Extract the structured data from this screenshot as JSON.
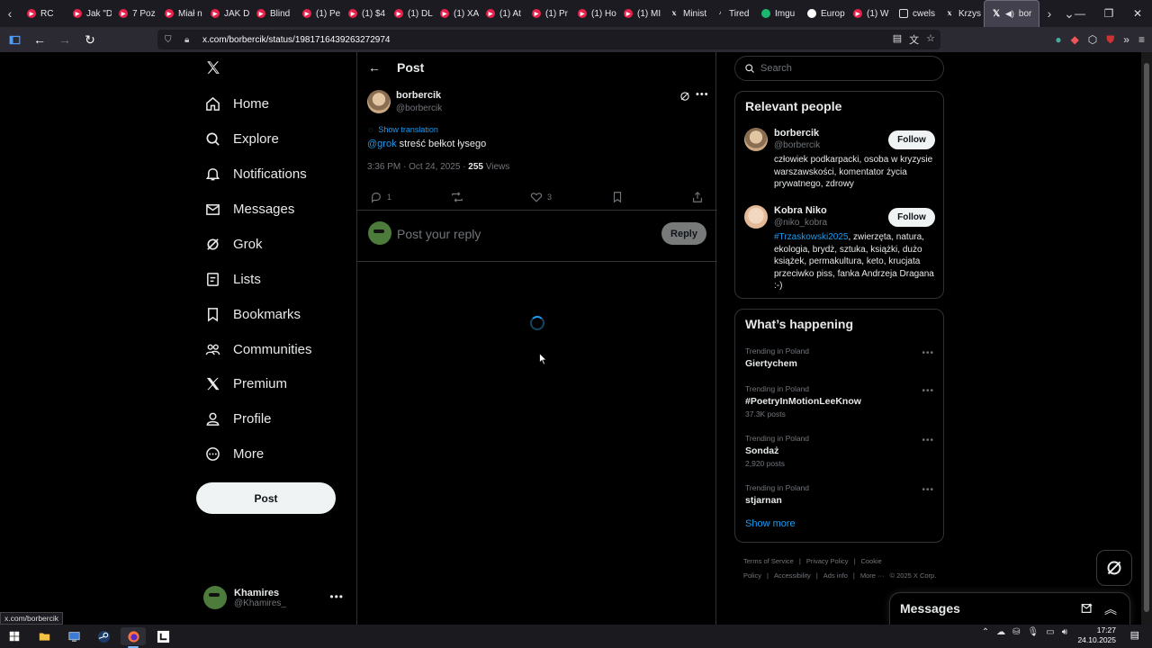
{
  "browser": {
    "tabs": [
      {
        "label": "RC",
        "favicon": "yt"
      },
      {
        "label": "Jak \"D",
        "favicon": "yt"
      },
      {
        "label": "7 Poz",
        "favicon": "yt"
      },
      {
        "label": "Miał n",
        "favicon": "yt"
      },
      {
        "label": "JAK D",
        "favicon": "yt"
      },
      {
        "label": "Blind",
        "favicon": "yt"
      },
      {
        "label": "(1) Pe",
        "favicon": "yt"
      },
      {
        "label": "(1) $4",
        "favicon": "yt"
      },
      {
        "label": "(1) DL",
        "favicon": "yt"
      },
      {
        "label": "(1) XA",
        "favicon": "yt"
      },
      {
        "label": "(1) At",
        "favicon": "yt"
      },
      {
        "label": "(1) Pr",
        "favicon": "yt"
      },
      {
        "label": "(1) Ho",
        "favicon": "yt"
      },
      {
        "label": "(1) MI",
        "favicon": "yt"
      },
      {
        "label": "Minist",
        "favicon": "xx"
      },
      {
        "label": "Tired",
        "favicon": "tt"
      },
      {
        "label": "Imgu",
        "favicon": "imgur"
      },
      {
        "label": "Europ",
        "favicon": "eu"
      },
      {
        "label": "(1) W",
        "favicon": "yt"
      },
      {
        "label": "cwels",
        "favicon": "cw"
      },
      {
        "label": "Krzys",
        "favicon": "xx"
      }
    ],
    "active_tab": {
      "label": "bor",
      "favicon": "xx"
    },
    "url": "x.com/borbercik/status/1981716439263272974",
    "status_url": "x.com/borbercik"
  },
  "nav": {
    "items": [
      {
        "label": "Home",
        "icon": "home-icon"
      },
      {
        "label": "Explore",
        "icon": "search-icon"
      },
      {
        "label": "Notifications",
        "icon": "bell-icon"
      },
      {
        "label": "Messages",
        "icon": "envelope-icon"
      },
      {
        "label": "Grok",
        "icon": "grok-icon"
      },
      {
        "label": "Lists",
        "icon": "list-icon"
      },
      {
        "label": "Bookmarks",
        "icon": "bookmark-icon"
      },
      {
        "label": "Communities",
        "icon": "people-icon"
      },
      {
        "label": "Premium",
        "icon": "x-icon"
      },
      {
        "label": "Profile",
        "icon": "person-icon"
      },
      {
        "label": "More",
        "icon": "more-circle-icon"
      }
    ],
    "post_button": "Post",
    "account": {
      "name": "Khamires",
      "handle": "@Khamires_"
    }
  },
  "post": {
    "header_title": "Post",
    "author_name": "borbercik",
    "author_handle": "@borbercik",
    "show_translation": "Show translation",
    "mention": "@grok",
    "text": " streść bełkot łysego",
    "time": "3:36 PM · Oct 24, 2025 · ",
    "views_count": "255",
    "views_label": " Views",
    "replies": "1",
    "likes": "3",
    "reply_placeholder": "Post your reply",
    "reply_button": "Reply"
  },
  "right": {
    "search_placeholder": "Search",
    "relevant_title": "Relevant people",
    "people": [
      {
        "name": "borbercik",
        "handle": "@borbercik",
        "follow": "Follow",
        "bio_tag": "",
        "bio": "człowiek podkarpacki, osoba w kryzysie warszawskości, komentator życia prywatnego, zdrowy"
      },
      {
        "name": "Kobra Niko",
        "handle": "@niko_kobra",
        "follow": "Follow",
        "bio_tag": "#Trzaskowski2025",
        "bio": ", zwierzęta, natura, ekologia, brydż, sztuka, książki, dużo książek, permakultura, keto, krucjata przeciwko piss, fanka Andrzeja Dragana :-)"
      }
    ],
    "happening_title": "What’s happening",
    "trends": [
      {
        "context": "Trending in Poland",
        "name": "Giertychem",
        "count": ""
      },
      {
        "context": "Trending in Poland",
        "name": "#PoetryInMotionLeeKnow",
        "count": "37.3K posts"
      },
      {
        "context": "Trending in Poland",
        "name": "Sondaż",
        "count": "2,920 posts"
      },
      {
        "context": "Trending in Poland",
        "name": "stjarnan",
        "count": ""
      }
    ],
    "show_more": "Show more",
    "footer_links": [
      "Terms of Service",
      "|",
      "Privacy Policy",
      "|",
      "Cookie Policy",
      "|",
      "Accessibility",
      "|",
      "Ads info",
      "|",
      "More ···",
      "© 2025 X Corp."
    ]
  },
  "messages_drawer": {
    "title": "Messages"
  },
  "taskbar": {
    "time": "17:27",
    "date": "24.10.2025"
  },
  "colors": {
    "accent": "#1d9bf0",
    "text": "#e7e9ea",
    "muted": "#71767b",
    "border": "#2f3336"
  }
}
